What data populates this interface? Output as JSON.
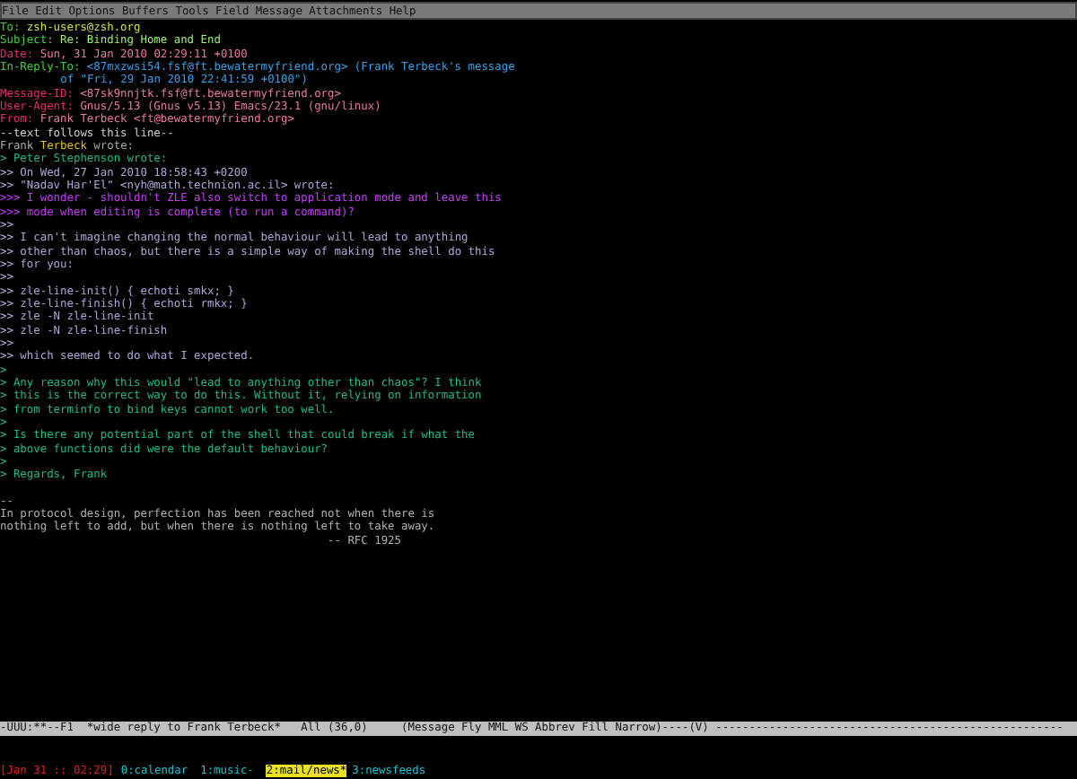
{
  "menu_bar": [
    "File",
    "Edit",
    "Options",
    "Buffers",
    "Tools",
    "Field",
    "Message",
    "Attachments",
    "Help"
  ],
  "headers": [
    {
      "kind": "recipient",
      "label": "To:",
      "value": "zsh-users@zsh.org"
    },
    {
      "kind": "subject",
      "label": "Subject:",
      "value": "Re: Binding Home and End"
    },
    {
      "kind": "meta",
      "label": "Date:",
      "value": "Sun, 31 Jan 2010 02:29:11 +0100"
    },
    {
      "kind": "reference",
      "label": "In-Reply-To:",
      "value": "<87mxzwsi54.fsf@ft.bewatermyfriend.org> (Frank Terbeck's message",
      "continuation": "of \"Fri, 29 Jan 2010 22:41:59 +0100\")"
    },
    {
      "kind": "meta",
      "label": "Message-ID:",
      "value": "<87sk9nnjtk.fsf@ft.bewatermyfriend.org>"
    },
    {
      "kind": "meta",
      "label": "User-Agent:",
      "value": "Gnus/5.13 (Gnus v5.13) Emacs/23.1 (gnu/linux)"
    },
    {
      "kind": "meta",
      "label": "From:",
      "value": "Frank Terbeck <ft@bewatermyfriend.org>"
    }
  ],
  "separator": "--text follows this line--",
  "body": [
    {
      "kind": "attribution",
      "segments": [
        {
          "text": "Frank ",
          "highlighted": false
        },
        {
          "text": "Terbeck",
          "highlighted": true
        },
        {
          "text": " wrote:",
          "highlighted": false
        }
      ]
    },
    {
      "kind": "quote1",
      "text": "> Peter Stephenson wrote:"
    },
    {
      "kind": "quote2",
      "text": ">> On Wed, 27 Jan 2010 18:58:43 +0200"
    },
    {
      "kind": "quote2",
      "text": ">> \"Nadav Har'El\" <nyh@math.technion.ac.il> wrote:"
    },
    {
      "kind": "quote3",
      "text": ">>> I wonder - shouldn't ZLE also switch to application mode and leave this"
    },
    {
      "kind": "quote3",
      "text": ">>> mode when editing is complete (to run a command)?"
    },
    {
      "kind": "quote2",
      "text": ">>"
    },
    {
      "kind": "quote2",
      "text": ">> I can't imagine changing the normal behaviour will lead to anything"
    },
    {
      "kind": "quote2",
      "text": ">> other than chaos, but there is a simple way of making the shell do this"
    },
    {
      "kind": "quote2",
      "text": ">> for you:"
    },
    {
      "kind": "quote2",
      "text": ">>"
    },
    {
      "kind": "quote2",
      "text": ">> zle-line-init() { echoti smkx; }"
    },
    {
      "kind": "quote2",
      "text": ">> zle-line-finish() { echoti rmkx; }"
    },
    {
      "kind": "quote2",
      "text": ">> zle -N zle-line-init"
    },
    {
      "kind": "quote2",
      "text": ">> zle -N zle-line-finish"
    },
    {
      "kind": "quote2",
      "text": ">>"
    },
    {
      "kind": "quote2",
      "text": ">> which seemed to do what I expected."
    },
    {
      "kind": "quote1",
      "text": ">"
    },
    {
      "kind": "quote1",
      "text": "> Any reason why this would \"lead to anything other than chaos\"? I think"
    },
    {
      "kind": "quote1",
      "text": "> this is the correct way to do this. Without it, relying on information"
    },
    {
      "kind": "quote1",
      "text": "> from terminfo to bind keys cannot work too well."
    },
    {
      "kind": "quote1",
      "text": ">"
    },
    {
      "kind": "quote1",
      "text": "> Is there any potential part of the shell that could break if what the"
    },
    {
      "kind": "quote1",
      "text": "> above functions did were the default behaviour?"
    },
    {
      "kind": "quote1",
      "text": ">"
    },
    {
      "kind": "quote1",
      "text": "> Regards, Frank"
    },
    {
      "kind": "blank"
    },
    {
      "kind": "signature",
      "text": "--"
    },
    {
      "kind": "signature",
      "text": "In protocol design, perfection has been reached not when there is"
    },
    {
      "kind": "signature",
      "text": "nothing left to add, but when there is nothing left to take away."
    },
    {
      "kind": "signature",
      "text": "                                                 -- RFC 1925"
    }
  ],
  "mode_line": "-UUU:**--F1  *wide reply to Frank Terbeck*   All (36,0)     (Message Fly MML WS Abbrev Fill Narrow)----(V) ----------------------------------------------------",
  "status_bar": {
    "clock": "[Jan 31 :: 02:29]",
    "windows": [
      {
        "label": "0:calendar",
        "selected": false
      },
      {
        "label": "1:music-",
        "selected": false
      },
      {
        "label": "2:mail/news*",
        "selected": true
      },
      {
        "label": "3:newsfeeds",
        "selected": false
      }
    ]
  }
}
